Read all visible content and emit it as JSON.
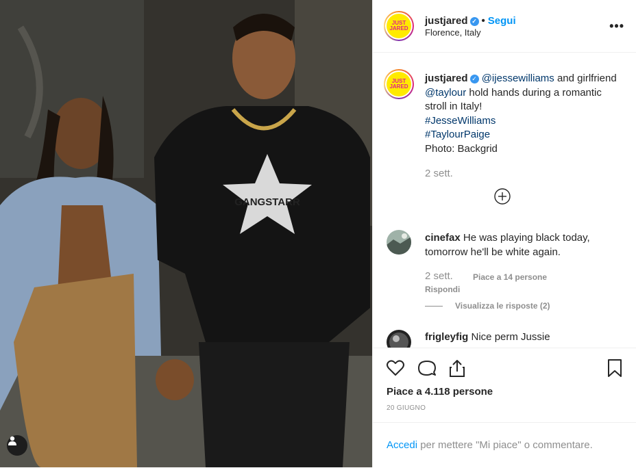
{
  "post": {
    "username": "justjared",
    "logo_text": "JUST JARED",
    "dot": "•",
    "follow_label": "Segui",
    "location": "Florence, Italy",
    "more_glyph": "•••",
    "verified_glyph": "✓",
    "photo_text": "GANGSTARR"
  },
  "caption": {
    "username": "justjared",
    "mention1": "@ijessewilliams",
    "text1": " and girlfriend ",
    "mention2": "@taylour",
    "text2": " hold hands during a romantic stroll in Italy!",
    "hashtag1": "#JesseWilliams",
    "hashtag2": "#TaylourPaige",
    "credit": "Photo: Backgrid",
    "time": "2 sett."
  },
  "comments": [
    {
      "username": "cinefax",
      "text": "He was playing black today, tomorrow he'll be white again.",
      "time": "2 sett.",
      "likes": "Piace a 14 persone",
      "reply": "Rispondi",
      "view_replies": "Visualizza le risposte (2)"
    },
    {
      "username": "frigleyfig",
      "text": "Nice perm Jussie"
    }
  ],
  "actions": {
    "likes": "Piace a 4.118 persone",
    "date": "20 GIUGNO",
    "icons": [
      "heart-icon",
      "comment-icon",
      "share-icon",
      "bookmark-icon"
    ]
  },
  "login": {
    "link": "Accedi",
    "text": " per mettere \"Mi piace\" o commentare."
  },
  "colors": {
    "accent": "#0095f6",
    "verified": "#3897f0",
    "muted": "#8e8e8e"
  }
}
